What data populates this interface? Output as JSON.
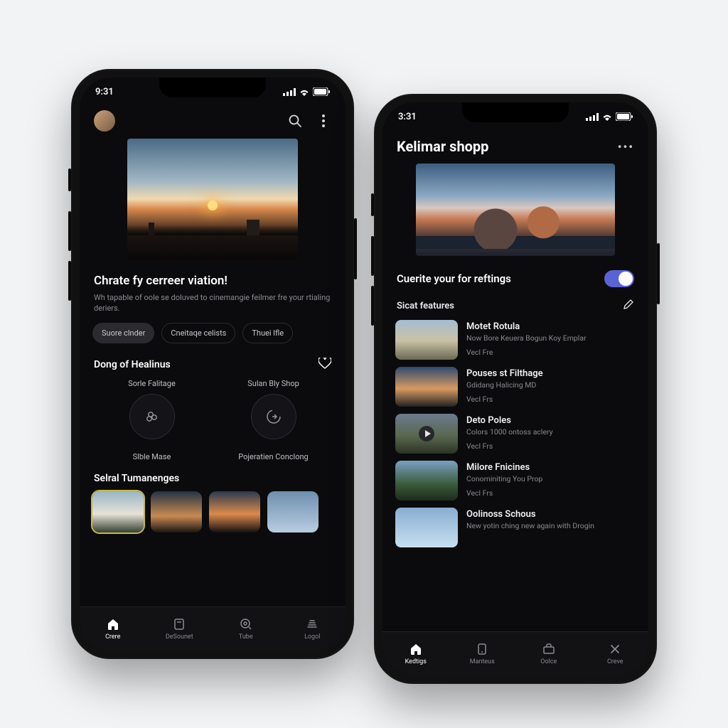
{
  "phoneA": {
    "status": {
      "time": "9:31"
    },
    "hero": {
      "title": "Chrate fy cerreer viation!",
      "subtitle": "Wh tapable of oole se doluved to cinemangie feilmer fre your rtialing deriers."
    },
    "chips": [
      {
        "label": "Suore clnder",
        "active": true
      },
      {
        "label": "Cneitaqe celists",
        "active": false
      },
      {
        "label": "Thuei lfle",
        "active": false
      }
    ],
    "section1": {
      "title": "Dong of Healinus"
    },
    "grid": [
      {
        "label": "Sorle Falitage"
      },
      {
        "label": "Sulan Bly Shop"
      },
      {
        "label": "Slble Mase"
      },
      {
        "label": "Pojeratien Conclong"
      }
    ],
    "section2": {
      "title": "Selral Tumanenges"
    },
    "tabs": [
      {
        "label": "Crere",
        "active": true
      },
      {
        "label": "DeSounet",
        "active": false
      },
      {
        "label": "Tube",
        "active": false
      },
      {
        "label": "Logol",
        "active": false
      }
    ]
  },
  "phoneB": {
    "status": {
      "time": "3:31"
    },
    "title": "Kelimar shopp",
    "toggle": {
      "label": "Cuerite your for reftings",
      "on": true
    },
    "features": {
      "title": "Sicat features"
    },
    "list": [
      {
        "title": "Motet Rotula",
        "sub": "Now Bore Keuera Bogun Koy Emplar",
        "meta": "Vecl Fre"
      },
      {
        "title": "Pouses st Filthage",
        "sub": "Gdidang Halicing MD",
        "meta": "Vecl Frs"
      },
      {
        "title": "Deto Poles",
        "sub": "Colors 1000 ontoss aclery",
        "meta": "Vecl Frs"
      },
      {
        "title": "Milore Fnicines",
        "sub": "Conominiting You Prop",
        "meta": "Vecl Frs"
      },
      {
        "title": "Oolinoss Schous",
        "sub": "New yotin ching new again with Drogin",
        "meta": ""
      }
    ],
    "tabs": [
      {
        "label": "Kedtigs",
        "active": true
      },
      {
        "label": "Manteus",
        "active": false
      },
      {
        "label": "Oolce",
        "active": false
      },
      {
        "label": "Creve",
        "active": false
      }
    ]
  }
}
